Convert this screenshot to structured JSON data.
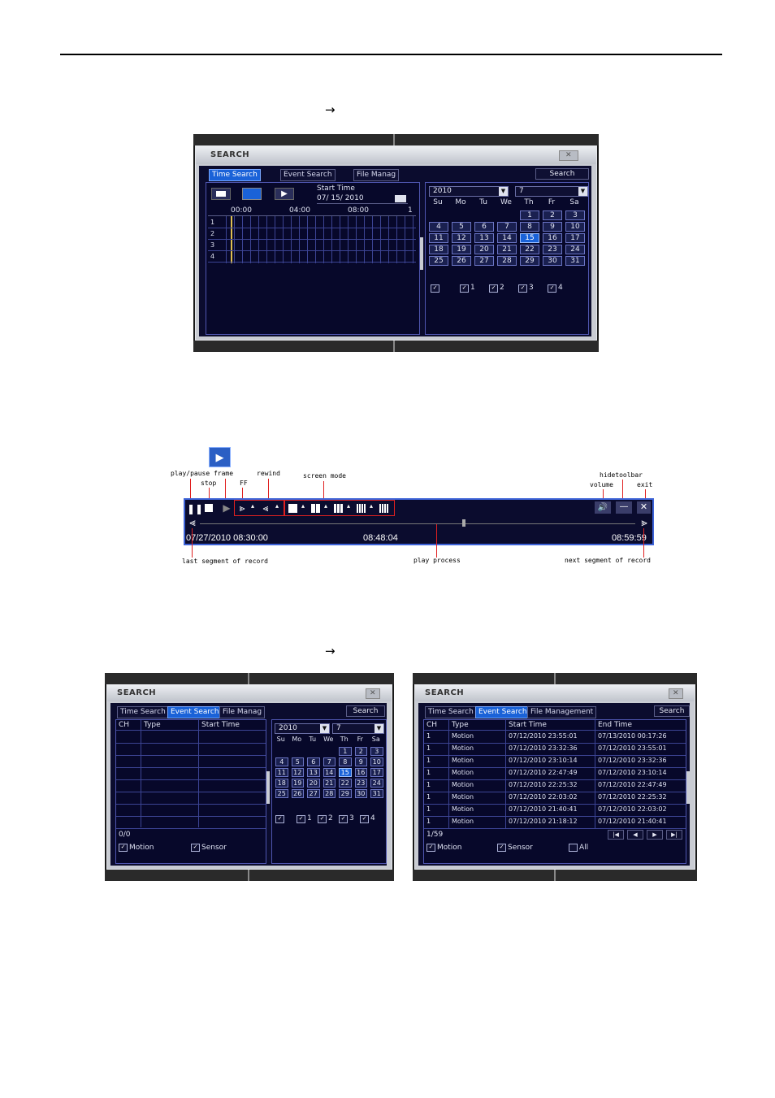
{
  "arrow": "→",
  "window_title": "SEARCH",
  "close_symbol": "✕",
  "tabs_top": [
    "Time Search",
    "Event Search",
    "File Manag"
  ],
  "tabs_left": [
    "Time Search",
    "Event Search",
    "File Manag"
  ],
  "tabs_right": [
    "Time Search",
    "Event Search",
    "File Management"
  ],
  "search_label": "Search",
  "start_time_label": "Start Time",
  "start_time_value": "07/ 15/ 2010",
  "timeline_hours": [
    "00:00",
    "04:00",
    "08:00"
  ],
  "timeline_end": "1",
  "channel_numbers": [
    "1",
    "2",
    "3",
    "4"
  ],
  "year": "2010",
  "month": "7",
  "weekdays": [
    "Su",
    "Mo",
    "Tu",
    "We",
    "Th",
    "Fr",
    "Sa"
  ],
  "days": [
    "1",
    "2",
    "3",
    "4",
    "5",
    "6",
    "7",
    "8",
    "9",
    "10",
    "11",
    "12",
    "13",
    "14",
    "15",
    "16",
    "17",
    "18",
    "19",
    "20",
    "21",
    "22",
    "23",
    "24",
    "25",
    "26",
    "27",
    "28",
    "29",
    "30",
    "31"
  ],
  "today": "15",
  "channel_checks": [
    "1",
    "2",
    "3",
    "4"
  ],
  "toolbar_labels": {
    "play_pause": "play/pause frame",
    "stop": "stop",
    "ff": "FF",
    "rewind": "rewind",
    "screen_mode": "screen mode",
    "hide_toolbar": "hidetoolbar",
    "volume": "volume",
    "exit": "exit",
    "last_segment": "last  segment  of  record",
    "play_process": "play  process",
    "next_segment": "next  segment  of  record"
  },
  "toolbar_times": {
    "start": "07/27/2010  08:30:00",
    "current": "08:48:04",
    "end": "08:59:59"
  },
  "event_headers_left": [
    "CH",
    "Type",
    "Start Time"
  ],
  "event_count_left": "0/0",
  "event_headers_right": [
    "CH",
    "Type",
    "Start Time",
    "End Time"
  ],
  "events": [
    {
      "ch": "1",
      "type": "Motion",
      "start": "07/12/2010 23:55:01",
      "end": "07/13/2010 00:17:26"
    },
    {
      "ch": "1",
      "type": "Motion",
      "start": "07/12/2010 23:32:36",
      "end": "07/12/2010 23:55:01"
    },
    {
      "ch": "1",
      "type": "Motion",
      "start": "07/12/2010 23:10:14",
      "end": "07/12/2010 23:32:36"
    },
    {
      "ch": "1",
      "type": "Motion",
      "start": "07/12/2010 22:47:49",
      "end": "07/12/2010 23:10:14"
    },
    {
      "ch": "1",
      "type": "Motion",
      "start": "07/12/2010 22:25:32",
      "end": "07/12/2010 22:47:49"
    },
    {
      "ch": "1",
      "type": "Motion",
      "start": "07/12/2010 22:03:02",
      "end": "07/12/2010 22:25:32"
    },
    {
      "ch": "1",
      "type": "Motion",
      "start": "07/12/2010 21:40:41",
      "end": "07/12/2010 22:03:02"
    },
    {
      "ch": "1",
      "type": "Motion",
      "start": "07/12/2010 21:18:12",
      "end": "07/12/2010 21:40:41"
    }
  ],
  "event_count_right": "1/59",
  "filter_motion": "Motion",
  "filter_sensor": "Sensor",
  "filter_all": "All",
  "pager": [
    "|◀",
    "◀",
    "▶",
    "▶|"
  ]
}
